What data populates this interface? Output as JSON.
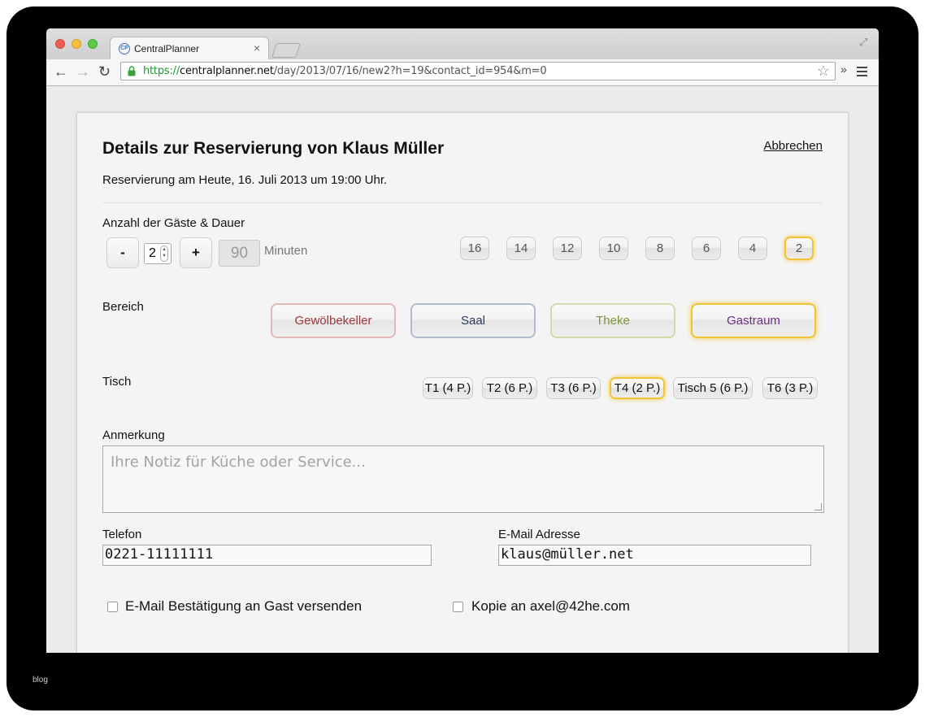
{
  "browser": {
    "tab_title": "CentralPlanner",
    "tab_favicon": "CP",
    "tab_close": "×",
    "url_scheme": "https://",
    "url_host": "centralplanner.net",
    "url_path": "/day/2013/07/16/new2?h=19&contact_id=954&m=0",
    "star": "☆",
    "overflow": "»"
  },
  "reservation": {
    "title": "Details zur Reservierung von Klaus Müller",
    "cancel_label": "Abbrechen",
    "subtitle": "Reservierung am Heute, 16. Juli 2013 um 19:00 Uhr."
  },
  "guests": {
    "label": "Anzahl der Gäste & Dauer",
    "minus": "-",
    "count": "2",
    "plus": "+",
    "duration": "90",
    "duration_unit": "Minuten",
    "quick_counts": [
      "16",
      "14",
      "12",
      "10",
      "8",
      "6",
      "4",
      "2"
    ],
    "selected": "2"
  },
  "area": {
    "label": "Bereich",
    "options": [
      {
        "label": "Gewölbekeller",
        "color": "#a0383b",
        "border": "#e2b8b8"
      },
      {
        "label": "Saal",
        "color": "#2a3a5e",
        "border": "#b3bcce"
      },
      {
        "label": "Theke",
        "color": "#7d9436",
        "border": "#ccdcaa"
      },
      {
        "label": "Gastraum",
        "color": "#6c2d86",
        "border": "#f1c232"
      }
    ],
    "selected": "Gastraum"
  },
  "table": {
    "label": "Tisch",
    "options": [
      "T1 (4 P.)",
      "T2 (6 P.)",
      "T3 (6 P.)",
      "T4 (2 P.)",
      "Tisch 5 (6 P.)",
      "T6 (3 P.)"
    ],
    "selected": "T4 (2 P.)"
  },
  "note": {
    "label": "Anmerkung",
    "placeholder": "Ihre Notiz für Küche oder Service..."
  },
  "phone": {
    "label": "Telefon",
    "value": "0221-11111111"
  },
  "email": {
    "label": "E-Mail Adresse",
    "value": "klaus@müller.net"
  },
  "checkboxes": [
    {
      "label": "E-Mail Bestätigung an Gast versenden",
      "checked": false
    },
    {
      "label": "Kopie an axel@42he.com",
      "checked": false
    }
  ],
  "watermark": "blog"
}
